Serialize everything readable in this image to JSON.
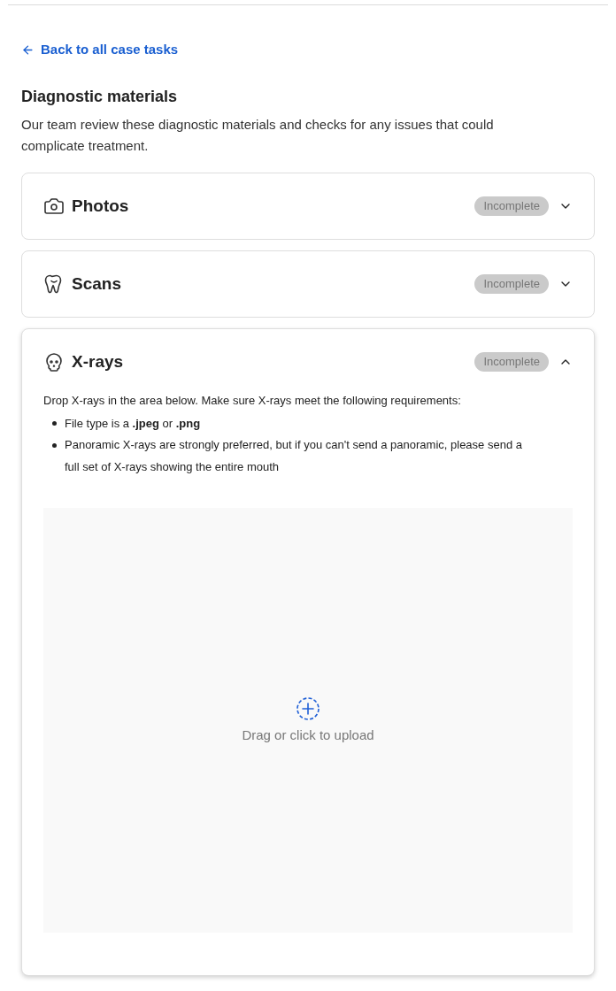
{
  "back_link": {
    "label": "Back to all case tasks"
  },
  "heading": "Diagnostic materials",
  "description": "Our team review these diagnostic materials and checks for any issues that could complicate treatment.",
  "sections": [
    {
      "title": "Photos",
      "status": "Incomplete",
      "expanded": false
    },
    {
      "title": "Scans",
      "status": "Incomplete",
      "expanded": false
    },
    {
      "title": "X-rays",
      "status": "Incomplete",
      "expanded": true,
      "instructions": "Drop X-rays in the area below. Make sure X-rays meet the following requirements:",
      "requirements": [
        "File type is a **.jpeg** or **.png**",
        "Panoramic X-rays are strongly preferred, but if you can't send a panoramic, please send a full set of X-rays showing the entire mouth"
      ],
      "dropzone": {
        "label": "Drag or click to upload"
      }
    }
  ]
}
